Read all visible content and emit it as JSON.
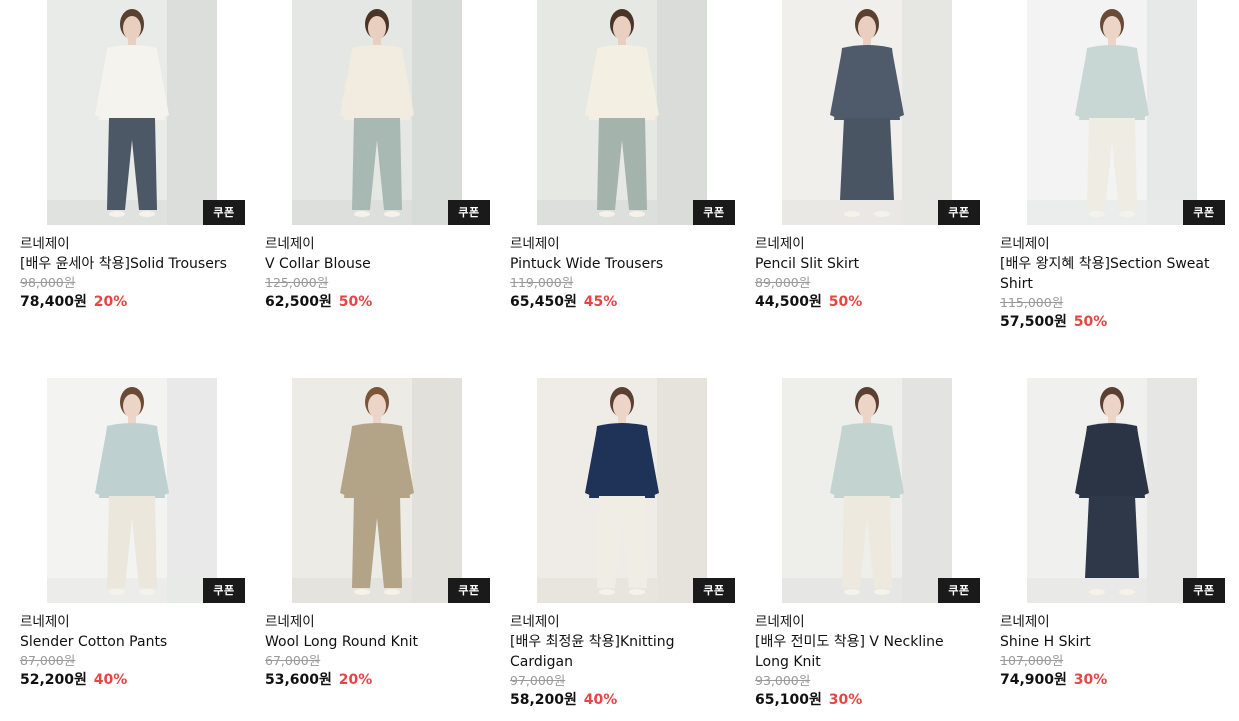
{
  "colors": {
    "discount": "#e84444",
    "coupon_bg": "#1a1a1a",
    "original_price": "#9a9a9a"
  },
  "products": [
    {
      "brand": "르네제이",
      "name": "[배우 윤세아 착용]Solid Trousers",
      "original_price": "98,000원",
      "price": "78,400원",
      "discount": "20%",
      "badge": "쿠폰",
      "image": {
        "bg": "#dcdedc",
        "wall": "#e9ebe9",
        "top": "#f4f3ee",
        "bottom": "#4d5866",
        "skin": "#e8cfbf",
        "hair": "#5a4030"
      }
    },
    {
      "brand": "르네제이",
      "name": "V Collar Blouse",
      "original_price": "125,000원",
      "price": "62,500원",
      "discount": "50%",
      "badge": "쿠폰",
      "image": {
        "bg": "#d8dcd9",
        "wall": "#e4e7e4",
        "top": "#f1ecdf",
        "bottom": "#a8b8b2",
        "skin": "#e8cfbf",
        "hair": "#4a3428"
      }
    },
    {
      "brand": "르네제이",
      "name": "Pintuck Wide Trousers",
      "original_price": "119,000원",
      "price": "65,450원",
      "discount": "45%",
      "badge": "쿠폰",
      "image": {
        "bg": "#d9dcd8",
        "wall": "#e6e8e4",
        "top": "#f3efe3",
        "bottom": "#a4b3ab",
        "skin": "#e8cfbf",
        "hair": "#4a3428"
      }
    },
    {
      "brand": "르네제이",
      "name": "Pencil Slit Skirt",
      "original_price": "89,000원",
      "price": "44,500원",
      "discount": "50%",
      "badge": "쿠폰",
      "image": {
        "bg": "#e6e6e2",
        "wall": "#f0efeb",
        "top": "#4f5a6a",
        "bottom": "#4a5563",
        "skin": "#e8cfbf",
        "hair": "#5a4030"
      }
    },
    {
      "brand": "르네제이",
      "name": "[배우 왕지혜 착용]Section Sweat Shirt",
      "original_price": "115,000원",
      "price": "57,500원",
      "discount": "50%",
      "badge": "쿠폰",
      "image": {
        "bg": "#e7e9e8",
        "wall": "#f2f3f2",
        "top": "#c9d7d4",
        "bottom": "#efece3",
        "skin": "#ecd5c6",
        "hair": "#6a4a35"
      }
    },
    {
      "brand": "르네제이",
      "name": "Slender Cotton Pants",
      "original_price": "87,000원",
      "price": "52,200원",
      "discount": "40%",
      "badge": "쿠폰",
      "image": {
        "bg": "#e8e9e8",
        "wall": "#f3f3f2",
        "top": "#bfd0d0",
        "bottom": "#ebe7dc",
        "skin": "#ecd5c6",
        "hair": "#6a4a35"
      }
    },
    {
      "brand": "르네제이",
      "name": "Wool Long Round Knit",
      "original_price": "67,000원",
      "price": "53,600원",
      "discount": "20%",
      "badge": "쿠폰",
      "image": {
        "bg": "#e2e0da",
        "wall": "#ecebe6",
        "top": "#b3a487",
        "bottom": "#b3a487",
        "skin": "#ecd5c6",
        "hair": "#7a5538"
      }
    },
    {
      "brand": "르네제이",
      "name": "[배우 최정윤 착용]Knitting Cardigan",
      "original_price": "97,000원",
      "price": "58,200원",
      "discount": "40%",
      "badge": "쿠폰",
      "image": {
        "bg": "#e6e2dc",
        "wall": "#efece7",
        "top": "#1f3257",
        "bottom": "#f0ede5",
        "skin": "#ecd5c6",
        "hair": "#5a4030"
      }
    },
    {
      "brand": "르네제이",
      "name": "[배우 전미도 착용] V Neckline Long Knit",
      "original_price": "93,000원",
      "price": "65,100원",
      "discount": "30%",
      "badge": "쿠폰",
      "image": {
        "bg": "#e3e4e1",
        "wall": "#eeeeeb",
        "top": "#c3d4d0",
        "bottom": "#ede9df",
        "skin": "#ecd5c6",
        "hair": "#5a4030"
      }
    },
    {
      "brand": "르네제이",
      "name": "Shine H Skirt",
      "original_price": "107,000원",
      "price": "74,900원",
      "discount": "30%",
      "badge": "쿠폰",
      "image": {
        "bg": "#e6e7e4",
        "wall": "#f0f0ee",
        "top": "#2b3445",
        "bottom": "#2f3849",
        "skin": "#ecd5c6",
        "hair": "#5a4030"
      }
    }
  ]
}
